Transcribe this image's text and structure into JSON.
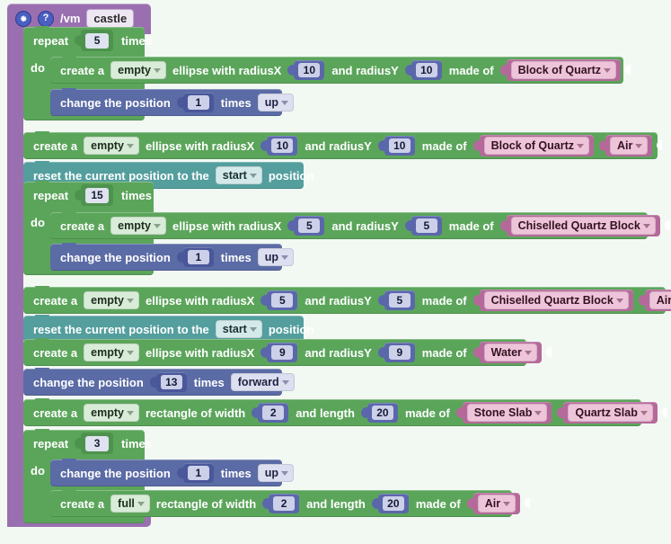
{
  "header": {
    "gear_icon": "gear-icon",
    "help_icon": "help-icon",
    "scope": "/vm",
    "procedure_name": "castle"
  },
  "labels": {
    "repeat": "repeat",
    "times": "times",
    "do": "do",
    "create_a": "create a",
    "ellipse_with_radiusx": "ellipse with radiusX",
    "and_radiusy": "and radiusY",
    "rectangle_of_width": "rectangle of width",
    "and_length": "and length",
    "made_of": "made of",
    "change_the_position": "change the position",
    "reset_position_pre": "reset the current position to  the",
    "reset_position_post": "position"
  },
  "colors": {
    "procedure": "#9a6fb0",
    "loop_green": "#5ba55b",
    "position_blue": "#5b6ba5",
    "reset_teal": "#549e9e",
    "material_pink": "#b5699a",
    "number_blue": "#5b67ab",
    "canvas": "#f2f9f3"
  },
  "blocks": [
    {
      "id": "repeat-1",
      "type": "repeat",
      "count": "5",
      "body": [
        {
          "id": "create-1",
          "type": "create-ellipse",
          "fill": "empty",
          "radiusx": "10",
          "radiusy": "10",
          "materials": [
            "Block of Quartz"
          ]
        },
        {
          "id": "move-1",
          "type": "change-position",
          "amount": "1",
          "direction": "up"
        }
      ]
    },
    {
      "id": "create-2",
      "type": "create-ellipse",
      "fill": "empty",
      "radiusx": "10",
      "radiusy": "10",
      "materials": [
        "Block of Quartz",
        "Air"
      ]
    },
    {
      "id": "reset-1",
      "type": "reset-position",
      "position": "start"
    },
    {
      "id": "repeat-2",
      "type": "repeat",
      "count": "15",
      "body": [
        {
          "id": "create-3",
          "type": "create-ellipse",
          "fill": "empty",
          "radiusx": "5",
          "radiusy": "5",
          "materials": [
            "Chiselled Quartz Block"
          ]
        },
        {
          "id": "move-2",
          "type": "change-position",
          "amount": "1",
          "direction": "up"
        }
      ]
    },
    {
      "id": "create-4",
      "type": "create-ellipse",
      "fill": "empty",
      "radiusx": "5",
      "radiusy": "5",
      "materials": [
        "Chiselled Quartz Block",
        "Air"
      ]
    },
    {
      "id": "reset-2",
      "type": "reset-position",
      "position": "start"
    },
    {
      "id": "create-5",
      "type": "create-ellipse",
      "fill": "empty",
      "radiusx": "9",
      "radiusy": "9",
      "materials": [
        "Water"
      ]
    },
    {
      "id": "move-3",
      "type": "change-position",
      "amount": "13",
      "direction": "forward"
    },
    {
      "id": "create-6",
      "type": "create-rectangle",
      "fill": "empty",
      "width": "2",
      "length": "20",
      "materials": [
        "Stone Slab",
        "Quartz Slab"
      ]
    },
    {
      "id": "repeat-3",
      "type": "repeat",
      "count": "3",
      "body": [
        {
          "id": "move-4",
          "type": "change-position",
          "amount": "1",
          "direction": "up"
        },
        {
          "id": "create-7",
          "type": "create-rectangle",
          "fill": "full",
          "width": "2",
          "length": "20",
          "materials": [
            "Air"
          ]
        }
      ]
    }
  ]
}
